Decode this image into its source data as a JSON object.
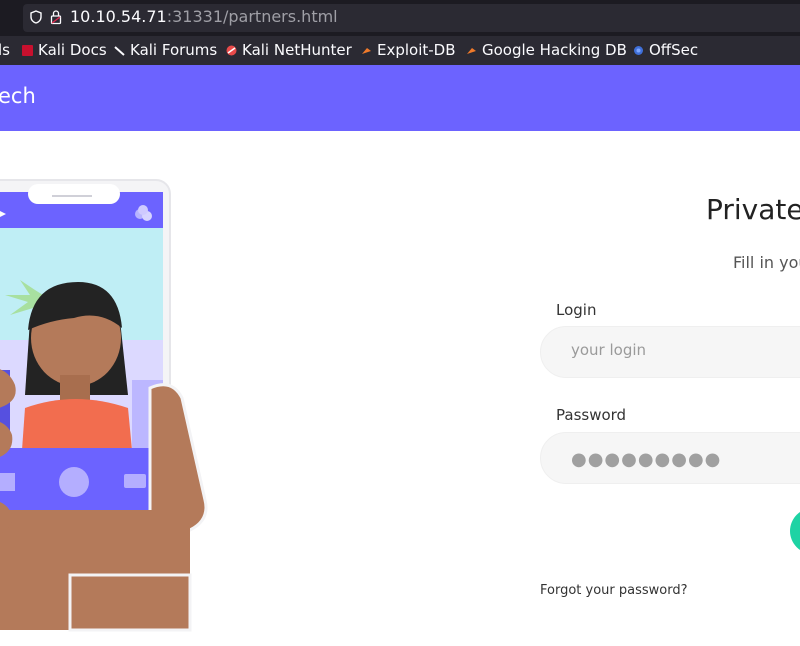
{
  "browser": {
    "url_host": "10.10.54.71",
    "url_path": ":31331/partners.html",
    "bookmarks": [
      {
        "label": "ls",
        "icon": "tools-icon"
      },
      {
        "label": "Kali Docs",
        "icon": "kali-docs-icon"
      },
      {
        "label": "Kali Forums",
        "icon": "kali-forums-icon"
      },
      {
        "label": "Kali NetHunter",
        "icon": "nethunter-icon"
      },
      {
        "label": "Exploit-DB",
        "icon": "exploit-db-icon"
      },
      {
        "label": "Google Hacking DB",
        "icon": "ghdb-icon"
      },
      {
        "label": "OffSec",
        "icon": "offsec-icon"
      }
    ]
  },
  "navbar": {
    "brand": "ech",
    "color": "#6c63ff"
  },
  "login": {
    "title": "Private",
    "subtitle": "Fill in you",
    "login_label": "Login",
    "login_placeholder": "your login",
    "password_label": "Password",
    "password_value": "●●●●●●●●●",
    "forgot_link": "Forgot your password?",
    "button_color": "#1ed3a4"
  }
}
